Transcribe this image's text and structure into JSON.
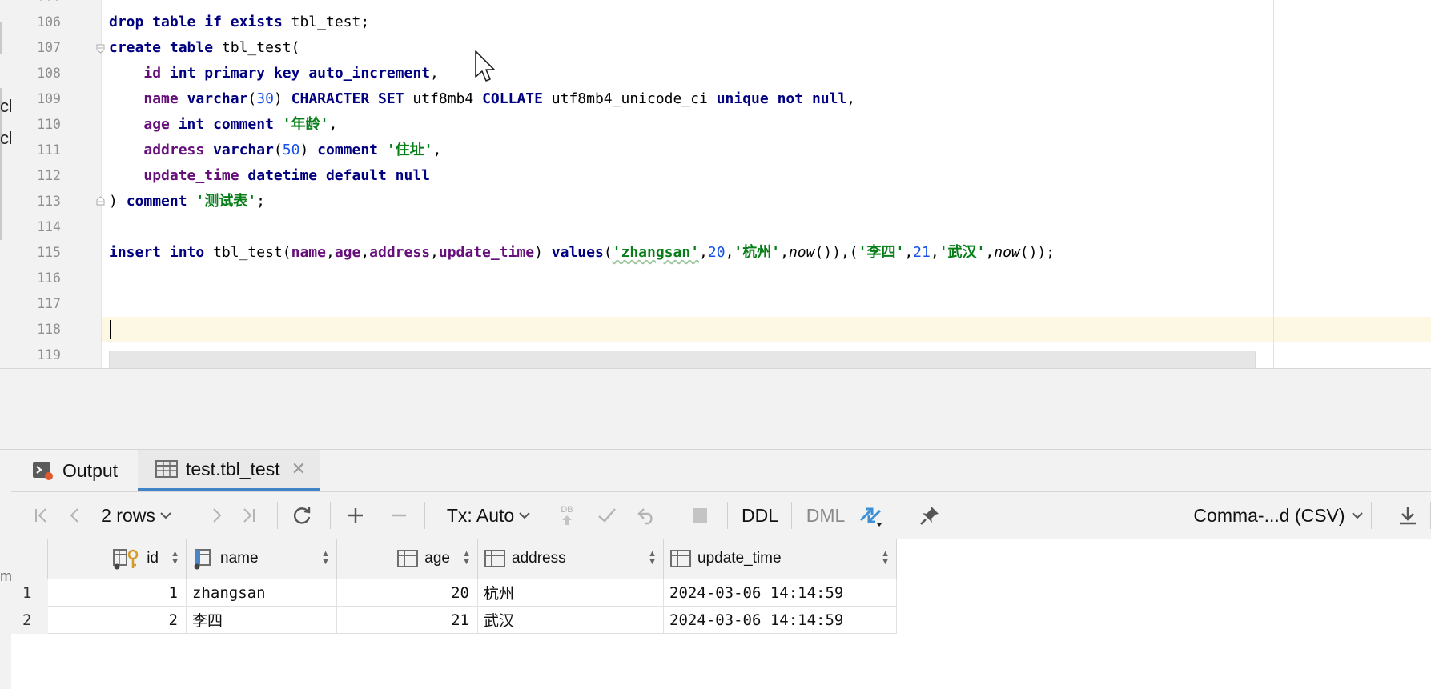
{
  "editor": {
    "line_numbers": [
      "106",
      "107",
      "108",
      "109",
      "110",
      "111",
      "112",
      "113",
      "114",
      "115",
      "116",
      "117",
      "118",
      "119"
    ],
    "lines": {
      "l106": {
        "kw1": "drop",
        "kw2": "table",
        "kw3": "if",
        "kw4": "exists",
        "rest": " tbl_test;"
      },
      "l107": {
        "kw1": "create",
        "kw2": "table",
        "rest": " tbl_test("
      },
      "l108": {
        "col": "id",
        "kw1": "int",
        "kw2": "primary",
        "kw3": "key",
        "kw4": "auto_increment",
        "rest": ","
      },
      "l109": {
        "col": "name",
        "kw1": "varchar",
        "p1": "(",
        "num": "30",
        "p2": ") ",
        "kw2": "CHARACTER",
        "kw3": "SET",
        "t1": " utf8mb4 ",
        "kw4": "COLLATE",
        "t2": " utf8mb4_unicode_ci ",
        "kw5": "unique",
        "kw6": "not",
        "kw7": "null",
        "rest": ","
      },
      "l110": {
        "col": "age",
        "kw1": "int",
        "kw2": "comment",
        "str": "'年龄'",
        "rest": ","
      },
      "l111": {
        "col": "address",
        "kw1": "varchar",
        "p1": "(",
        "num": "50",
        "p2": ") ",
        "kw2": "comment",
        "str": "'住址'",
        "rest": ","
      },
      "l112": {
        "col": "update_time",
        "kw1": "datetime",
        "kw2": "default",
        "kw3": "null"
      },
      "l113": {
        "p1": ") ",
        "kw1": "comment",
        "str": "'测试表'",
        "rest": ";"
      },
      "l115": {
        "kw1": "insert",
        "kw2": "into",
        "t1": " tbl_test(",
        "c1": "name",
        "c2": "age",
        "c3": "address",
        "c4": "update_time",
        "t2": ") ",
        "kw3": "values",
        "t3": "(",
        "s1": "'zhangsan'",
        "n1": "20",
        "s2": "'杭州'",
        "f1": "now",
        "t4": "()),(",
        "s3": "'李四'",
        "n2": "21",
        "s4": "'武汉'",
        "f2": "now",
        "t5": "());"
      }
    }
  },
  "left_fragments": [
    "cl",
    "cl",
    "m"
  ],
  "tabs": [
    {
      "label": "Output",
      "icon": "console-icon"
    },
    {
      "label": "test.tbl_test",
      "icon": "table-icon",
      "close": "✕"
    }
  ],
  "toolbar": {
    "rows_label": "2 rows",
    "tx_label": "Tx: Auto",
    "ddl_label": "DDL",
    "dml_label": "DML",
    "db_label": "DB",
    "export_label": "Comma-...d (CSV)"
  },
  "grid": {
    "columns": [
      {
        "label": "id",
        "icon": "key-column-icon"
      },
      {
        "label": "name",
        "icon": "indexed-column-icon"
      },
      {
        "label": "age",
        "icon": "column-icon"
      },
      {
        "label": "address",
        "icon": "column-icon"
      },
      {
        "label": "update_time",
        "icon": "column-icon"
      }
    ],
    "rows": [
      {
        "no": "1",
        "id": "1",
        "name": "zhangsan",
        "age": "20",
        "address": "杭州",
        "update_time": "2024-03-06 14:14:59"
      },
      {
        "no": "2",
        "id": "2",
        "name": "李四",
        "age": "21",
        "address": "武汉",
        "update_time": "2024-03-06 14:14:59"
      }
    ]
  },
  "colors": {
    "keyword": "#000080",
    "column": "#660e7a",
    "string": "#067d17",
    "number": "#1750eb",
    "accent": "#4083c9"
  }
}
